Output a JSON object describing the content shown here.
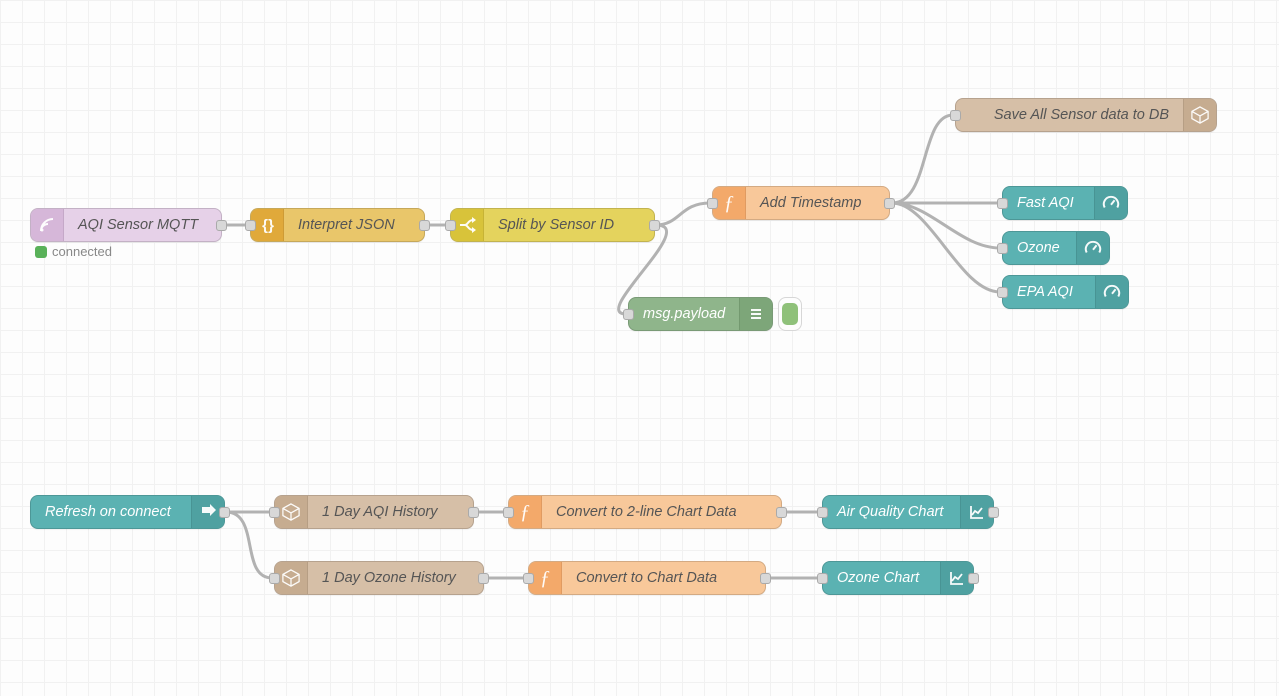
{
  "colors": {
    "mqtt_body": "#e6d1e8",
    "mqtt_icon": "#d6b7d9",
    "json_body": "#e9c66a",
    "json_icon": "#e0a93a",
    "switch_body": "#e4d35d",
    "switch_icon": "#d8c33a",
    "func_body": "#f8c89a",
    "func_icon": "#f3a96a",
    "debug_body": "#8fb58b",
    "debug_icon": "#7da679",
    "debug_toggle": "#8fc17a",
    "db_body": "#d6bfa7",
    "db_icon": "#c6ac90",
    "ui_body": "#5bb2b2",
    "ui_icon": "#4fa1a1",
    "link_body": "#d6bfa7",
    "link_icon": "#c6ac90",
    "status_green": "#59b159"
  },
  "nodes": {
    "mqtt": {
      "label": "AQI Sensor MQTT"
    },
    "json": {
      "label": "Interpret JSON"
    },
    "switch": {
      "label": "Split by Sensor ID"
    },
    "timestamp": {
      "label": "Add Timestamp"
    },
    "debug": {
      "label": "msg.payload"
    },
    "save_db": {
      "label": "Save All Sensor data to DB"
    },
    "fast_aqi": {
      "label": "Fast AQI"
    },
    "ozone": {
      "label": "Ozone"
    },
    "epa_aqi": {
      "label": "EPA AQI"
    },
    "refresh": {
      "label": "Refresh on connect"
    },
    "hist_aqi": {
      "label": "1 Day AQI History"
    },
    "hist_ozone": {
      "label": "1 Day Ozone History"
    },
    "conv_aqi": {
      "label": "Convert to 2-line Chart Data"
    },
    "conv_ozone": {
      "label": "Convert to Chart Data"
    },
    "chart_air": {
      "label": "Air Quality Chart"
    },
    "chart_ozone": {
      "label": "Ozone Chart"
    }
  },
  "status": {
    "mqtt": "connected"
  }
}
